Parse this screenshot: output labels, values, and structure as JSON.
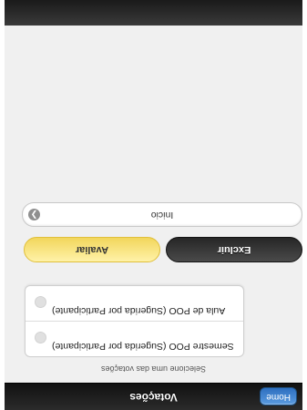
{
  "header": {
    "title": "Votações",
    "home_label": "Home"
  },
  "hint": "Selecione uma das votações",
  "options": [
    {
      "label": "Semestre POO (Sugerida por Participante)"
    },
    {
      "label": "Aula de POO (Sugerida por Participante)"
    }
  ],
  "actions": {
    "excluir_label": "Excluir",
    "avaliar_label": "Avaliar"
  },
  "nav": {
    "label": "Inicio",
    "back_icon": "back-arrow-icon"
  },
  "colors": {
    "header_bg": "#1a1a1a",
    "home_button": "#3b7fd1",
    "avaliar_button": "#f6dd6b",
    "excluir_button": "#333333",
    "page_bg": "#f0f0f0"
  }
}
